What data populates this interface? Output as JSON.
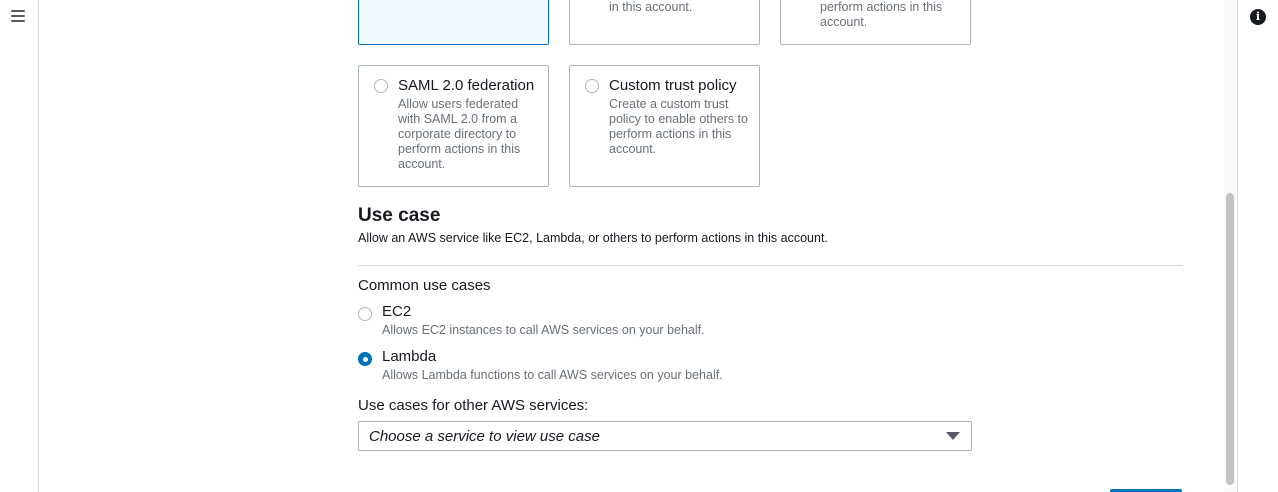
{
  "tiles_top": {
    "tile2_fragment": "in this account.",
    "tile3_fragment_line1": "perform actions in this",
    "tile3_fragment_line2": "account."
  },
  "tiles": [
    {
      "title": "SAML 2.0 federation",
      "description": "Allow users federated with SAML 2.0 from a corporate directory to perform actions in this account."
    },
    {
      "title": "Custom trust policy",
      "description": "Create a custom trust policy to enable others to perform actions in this account."
    }
  ],
  "use_case": {
    "heading": "Use case",
    "subtitle": "Allow an AWS service like EC2, Lambda, or others to perform actions in this account.",
    "common_label": "Common use cases",
    "options": [
      {
        "label": "EC2",
        "description": "Allows EC2 instances to call AWS services on your behalf.",
        "selected": false
      },
      {
        "label": "Lambda",
        "description": "Allows Lambda functions to call AWS services on your behalf.",
        "selected": true
      }
    ],
    "other_label": "Use cases for other AWS services:",
    "select_placeholder": "Choose a service to view use case"
  },
  "colors": {
    "accent": "#0073bb",
    "selected_tile_bg": "#f1faff",
    "muted_text": "#687078",
    "border": "#aab7b8"
  },
  "icons": {
    "menu": "hamburger-menu-icon",
    "info": "info-icon",
    "dropdown": "caret-down-icon"
  }
}
